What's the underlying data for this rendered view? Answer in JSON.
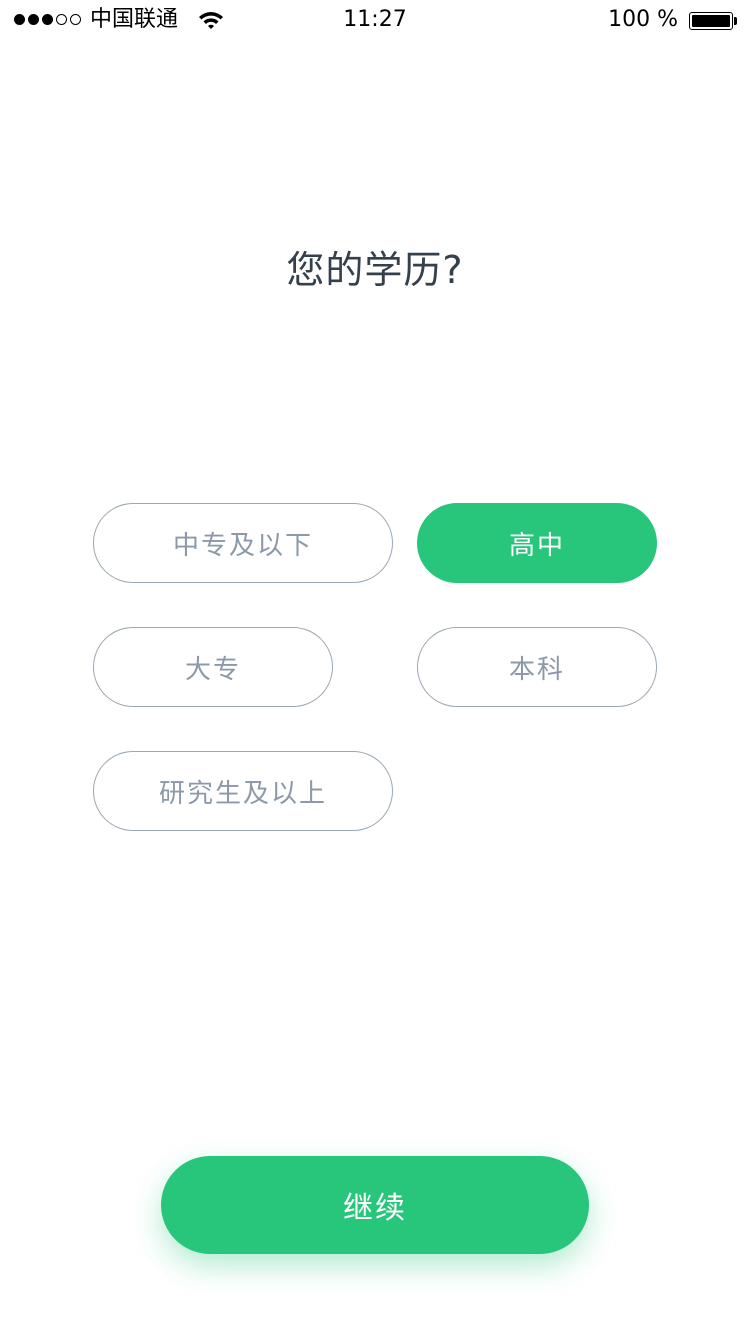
{
  "status_bar": {
    "signal_strength": 3,
    "signal_max": 5,
    "carrier": "中国联通",
    "wifi_icon": "wifi-icon",
    "time": "11:27",
    "battery_text": "100 %",
    "battery_level": 1.0
  },
  "question": {
    "title": "您的学历?"
  },
  "options": [
    {
      "label": "中专及以下",
      "selected": false
    },
    {
      "label": "高中",
      "selected": true
    },
    {
      "label": "大专",
      "selected": false
    },
    {
      "label": "本科",
      "selected": false
    },
    {
      "label": "研究生及以上",
      "selected": false
    }
  ],
  "continue_button": {
    "label": "继续"
  },
  "colors": {
    "accent": "#28c67b",
    "option_border": "#9aa7b5",
    "option_text": "#8c99a8",
    "title_text": "#34404b"
  }
}
